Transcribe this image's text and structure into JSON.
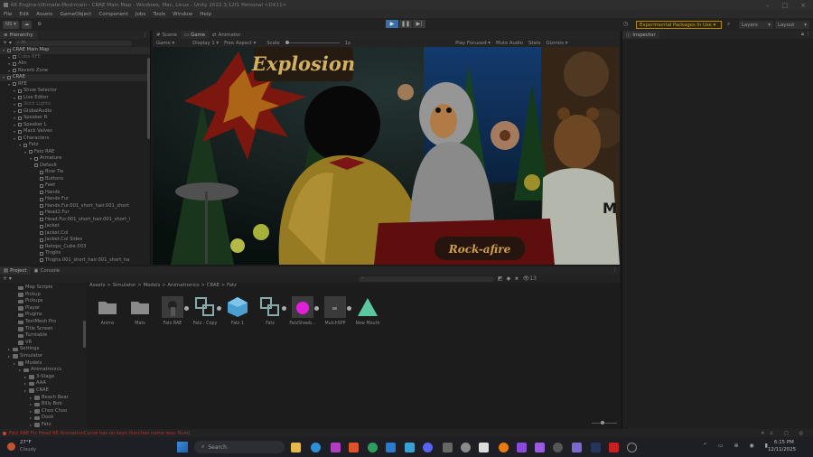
{
  "window": {
    "title": "KK Engine-Ultimate-Mod-main - CRAE Main Map - Windows, Mac, Linux - Unity 2022.3.12f1 Personal <DX11>"
  },
  "menu": [
    "File",
    "Edit",
    "Assets",
    "GameObject",
    "Component",
    "Jobs",
    "Tools",
    "Window",
    "Help"
  ],
  "toolbar": {
    "account": "NS",
    "experimental": "Experimental Packages In Use",
    "layers": "Layers",
    "layout": "Layout"
  },
  "hierarchy": {
    "tab": "Hierarchy",
    "search_placeholder": "All",
    "rows": [
      {
        "label": "CRAE Main Map",
        "depth": 0,
        "type": "scene"
      },
      {
        "label": "Cube RFE",
        "depth": 1,
        "type": "dim"
      },
      {
        "label": "Alin",
        "depth": 1,
        "type": "obj"
      },
      {
        "label": "Reverb Zone",
        "depth": 1,
        "type": "obj"
      },
      {
        "label": "CRAE",
        "depth": 0,
        "type": "scene"
      },
      {
        "label": "RFE",
        "depth": 1,
        "type": "obj"
      },
      {
        "label": "Show Selector",
        "depth": 2,
        "type": "obj"
      },
      {
        "label": "Live Editor",
        "depth": 2,
        "type": "obj"
      },
      {
        "label": "Stick Lights",
        "depth": 2,
        "type": "dim"
      },
      {
        "label": "GlobalAudio",
        "depth": 2,
        "type": "obj"
      },
      {
        "label": "Speaker R",
        "depth": 2,
        "type": "obj"
      },
      {
        "label": "Speaker L",
        "depth": 2,
        "type": "obj"
      },
      {
        "label": "Mack Valves",
        "depth": 2,
        "type": "obj"
      },
      {
        "label": "Characters",
        "depth": 2,
        "type": "obj"
      },
      {
        "label": "Fatz",
        "depth": 3,
        "type": "obj"
      },
      {
        "label": "Fatz RAE",
        "depth": 4,
        "type": "obj"
      },
      {
        "label": "Armature",
        "depth": 5,
        "type": "obj"
      },
      {
        "label": "Default",
        "depth": 5,
        "type": "obj"
      },
      {
        "label": "Bow Tie",
        "depth": 6,
        "type": "obj"
      },
      {
        "label": "Buttons",
        "depth": 6,
        "type": "obj"
      },
      {
        "label": "Feet",
        "depth": 6,
        "type": "obj"
      },
      {
        "label": "Hands",
        "depth": 6,
        "type": "obj"
      },
      {
        "label": "Hands Fur",
        "depth": 6,
        "type": "obj"
      },
      {
        "label": "Hands.Fur.001_short_hair.001_short",
        "depth": 6,
        "type": "obj"
      },
      {
        "label": "Head2.Fur",
        "depth": 6,
        "type": "obj"
      },
      {
        "label": "Head.Fur.001_short_hair.001_short_l",
        "depth": 6,
        "type": "obj"
      },
      {
        "label": "Jacket",
        "depth": 6,
        "type": "obj"
      },
      {
        "label": "Jacket.Col",
        "depth": 6,
        "type": "obj"
      },
      {
        "label": "Jacket.Col Sides",
        "depth": 6,
        "type": "obj"
      },
      {
        "label": "Retops_Cube.003",
        "depth": 6,
        "type": "obj"
      },
      {
        "label": "Thighs",
        "depth": 6,
        "type": "obj"
      },
      {
        "label": "Thighs.001_short_hair.001_short_ha",
        "depth": 6,
        "type": "obj"
      }
    ]
  },
  "views": {
    "tabs": [
      "Scene",
      "Game",
      "Animator"
    ],
    "active": "Game"
  },
  "gamebar": {
    "mode": "Game",
    "display": "Display 1",
    "aspect": "Free Aspect",
    "scale_label": "Scale",
    "scale_value": "1x",
    "play_focused": "Play Focused",
    "mute": "Mute Audio",
    "stats": "Stats",
    "gizmos": "Gizmos"
  },
  "scene": {
    "sign_top": "Explosion",
    "sign_bottom": "Rock-afire",
    "jacket_letter": "M"
  },
  "inspector": {
    "tab": "Inspector"
  },
  "project": {
    "tabs": [
      "Project",
      "Console"
    ],
    "hidden_count": "13",
    "breadcrumb": "Assets > Simulator > Models > Animatronics > CRAE > Fatz",
    "tree": [
      {
        "label": "Map Scripts",
        "depth": 2
      },
      {
        "label": "Pickup",
        "depth": 2
      },
      {
        "label": "Pickups",
        "depth": 2
      },
      {
        "label": "Player",
        "depth": 2
      },
      {
        "label": "Plugins",
        "depth": 2
      },
      {
        "label": "TextMesh Pro",
        "depth": 2
      },
      {
        "label": "Title Screen",
        "depth": 2
      },
      {
        "label": "Turntable",
        "depth": 2
      },
      {
        "label": "VR",
        "depth": 2
      },
      {
        "label": "Settings",
        "depth": 1
      },
      {
        "label": "Simulator",
        "depth": 1
      },
      {
        "label": "Models",
        "depth": 2
      },
      {
        "label": "Animatronics",
        "depth": 3
      },
      {
        "label": "3-Stage",
        "depth": 4
      },
      {
        "label": "AAA",
        "depth": 4
      },
      {
        "label": "CRAE",
        "depth": 4
      },
      {
        "label": "Beach Bear",
        "depth": 5
      },
      {
        "label": "Billy Bob",
        "depth": 5
      },
      {
        "label": "Choo Choo",
        "depth": 5
      },
      {
        "label": "Dook",
        "depth": 5
      },
      {
        "label": "Fatz",
        "depth": 5
      }
    ],
    "assets": [
      {
        "label": "Anims",
        "kind": "folder"
      },
      {
        "label": "Mats",
        "kind": "folder"
      },
      {
        "label": "Fatz RAE",
        "kind": "model"
      },
      {
        "label": "Fatz - Copy",
        "kind": "prefab"
      },
      {
        "label": "Fatz 1",
        "kind": "cube"
      },
      {
        "label": "Fatz",
        "kind": "prefab"
      },
      {
        "label": "FatzSheeb...",
        "kind": "magenta"
      },
      {
        "label": "MulchSPP",
        "kind": "model2"
      },
      {
        "label": "New Mouth",
        "kind": "tri"
      }
    ]
  },
  "status": {
    "message": "Fatz RAE Fix Head RE AnimationCurve has no keys (function name was: Bust)"
  },
  "taskbar": {
    "temp": "27°F",
    "weather": "Cloudy",
    "search": "Search",
    "time": "6:15 PM",
    "date": "12/11/2025"
  }
}
